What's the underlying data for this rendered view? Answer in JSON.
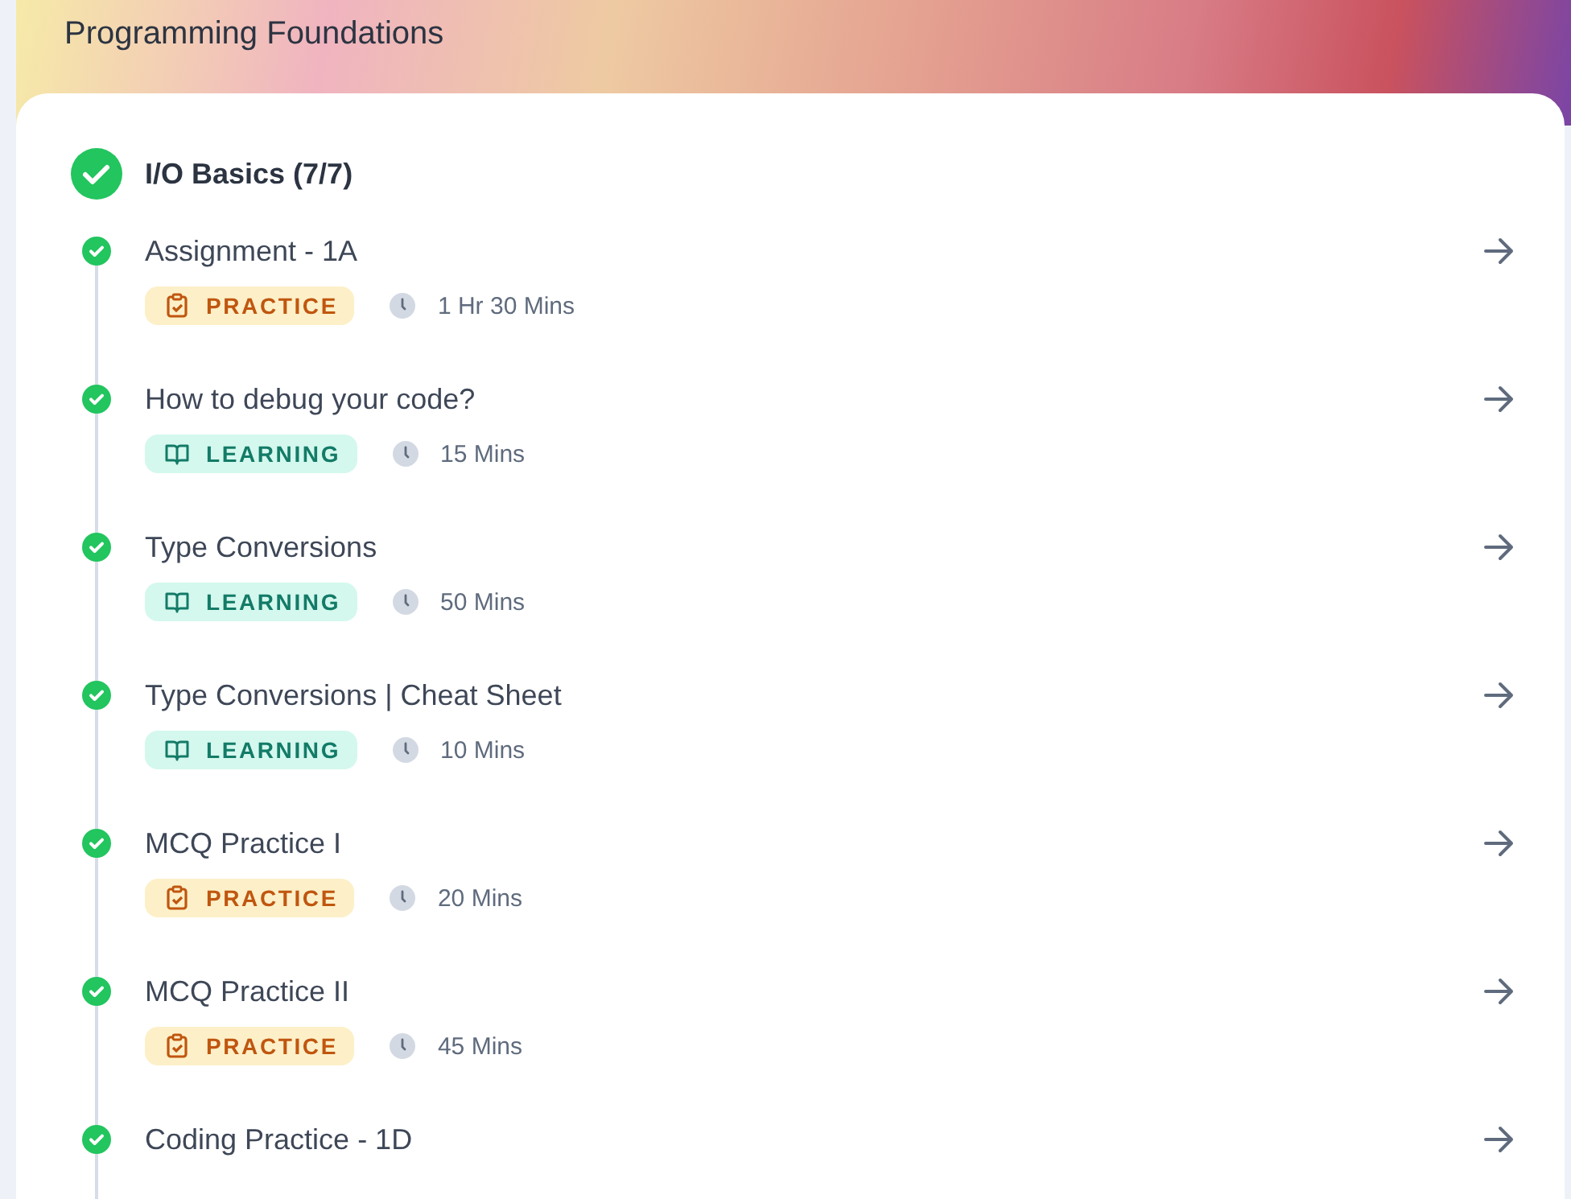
{
  "header": {
    "title": "Programming Foundations"
  },
  "section": {
    "title": "I/O Basics (7/7)",
    "completed": true
  },
  "items": [
    {
      "title": "Assignment - 1A",
      "completed": true,
      "kind": "practice",
      "tag": "PRACTICE",
      "duration": "1 Hr 30 Mins"
    },
    {
      "title": "How to debug your code?",
      "completed": true,
      "kind": "learning",
      "tag": "LEARNING",
      "duration": "15 Mins"
    },
    {
      "title": "Type Conversions",
      "completed": true,
      "kind": "learning",
      "tag": "LEARNING",
      "duration": "50 Mins"
    },
    {
      "title": "Type Conversions | Cheat Sheet",
      "completed": true,
      "kind": "learning",
      "tag": "LEARNING",
      "duration": "10 Mins"
    },
    {
      "title": "MCQ Practice I",
      "completed": true,
      "kind": "practice",
      "tag": "PRACTICE",
      "duration": "20 Mins"
    },
    {
      "title": "MCQ Practice II",
      "completed": true,
      "kind": "practice",
      "tag": "PRACTICE",
      "duration": "45 Mins"
    },
    {
      "title": "Coding Practice - 1D",
      "completed": true
    }
  ]
}
